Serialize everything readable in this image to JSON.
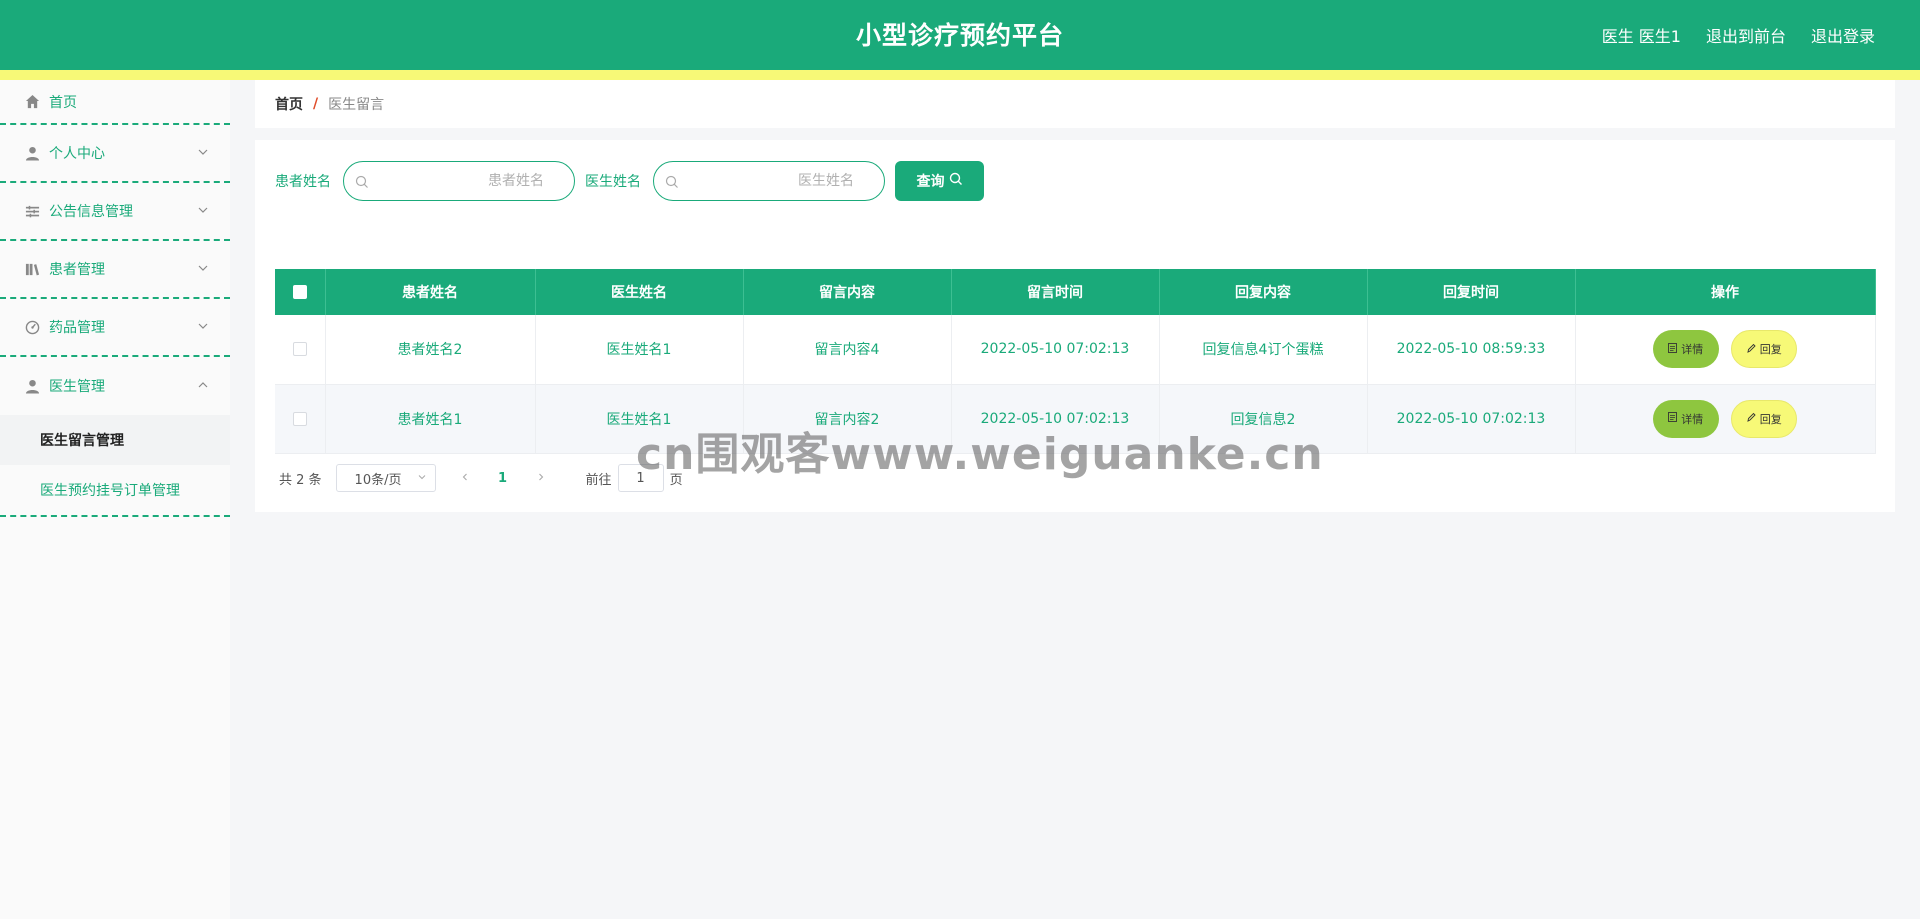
{
  "header": {
    "title": "小型诊疗预约平台",
    "links": [
      "医生 医生1",
      "退出到前台",
      "退出登录"
    ]
  },
  "sidebar": {
    "items": [
      {
        "label": "首页",
        "icon": "home-icon"
      },
      {
        "label": "个人中心",
        "icon": "user-icon"
      },
      {
        "label": "公告信息管理",
        "icon": "list-icon"
      },
      {
        "label": "患者管理",
        "icon": "books-icon"
      },
      {
        "label": "药品管理",
        "icon": "gauge-icon"
      },
      {
        "label": "医生管理",
        "icon": "user-icon"
      }
    ],
    "subitems": [
      "医生留言管理",
      "医生预约挂号订单管理"
    ]
  },
  "breadcrumb": {
    "home": "首页",
    "separator": "/",
    "current": "医生留言"
  },
  "search": {
    "patient_label": "患者姓名",
    "patient_placeholder": "患者姓名",
    "doctor_label": "医生姓名",
    "doctor_placeholder": "医生姓名",
    "query_label": "查询"
  },
  "table": {
    "headers": [
      "患者姓名",
      "医生姓名",
      "留言内容",
      "留言时间",
      "回复内容",
      "回复时间",
      "操作"
    ],
    "rows": [
      {
        "patient": "患者姓名2",
        "doctor": "医生姓名1",
        "content": "留言内容4",
        "time": "2022-05-10 07:02:13",
        "reply": "回复信息4订个蛋糕",
        "reply_time": "2022-05-10 08:59:33"
      },
      {
        "patient": "患者姓名1",
        "doctor": "医生姓名1",
        "content": "留言内容2",
        "time": "2022-05-10 07:02:13",
        "reply": "回复信息2",
        "reply_time": "2022-05-10 07:02:13"
      }
    ],
    "detail_label": "详情",
    "reply_label": "回复"
  },
  "pagination": {
    "total": "共 2 条",
    "page_size": "10条/页",
    "current_page": "1",
    "goto_label": "前往",
    "goto_value": "1",
    "page_unit": "页"
  },
  "watermark": "cn围观客www.weiguanke.cn",
  "colors": {
    "primary": "#1aaa7a",
    "accent_yellow": "#f7f977",
    "detail_green": "#8ec63f"
  }
}
